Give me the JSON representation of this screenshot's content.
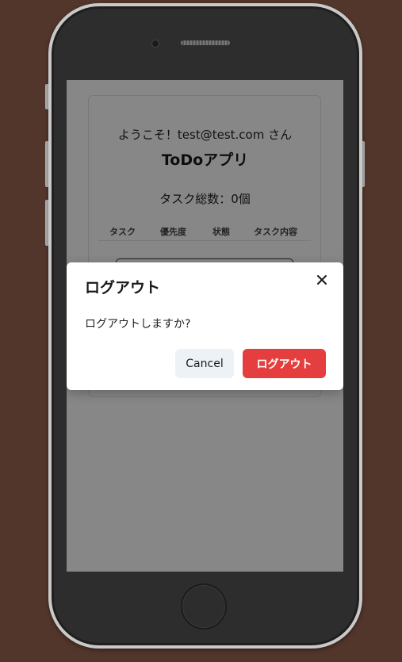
{
  "app": {
    "welcome_text": "ようこそ！test@test.com さん",
    "title": "ToDoアプリ",
    "task_count_text": "タスク総数：0個",
    "table_headers": [
      "タスク",
      "優先度",
      "状態",
      "タスク内容"
    ]
  },
  "modal": {
    "title": "ログアウト",
    "message": "ログアウトしますか?",
    "cancel_label": "Cancel",
    "confirm_label": "ログアウト",
    "close_icon": "close-icon"
  },
  "colors": {
    "background": "#53362b",
    "overlay": "rgba(0,0,0,0.47)",
    "confirm_button": "#e53e3e",
    "cancel_button": "#edf2f7"
  }
}
